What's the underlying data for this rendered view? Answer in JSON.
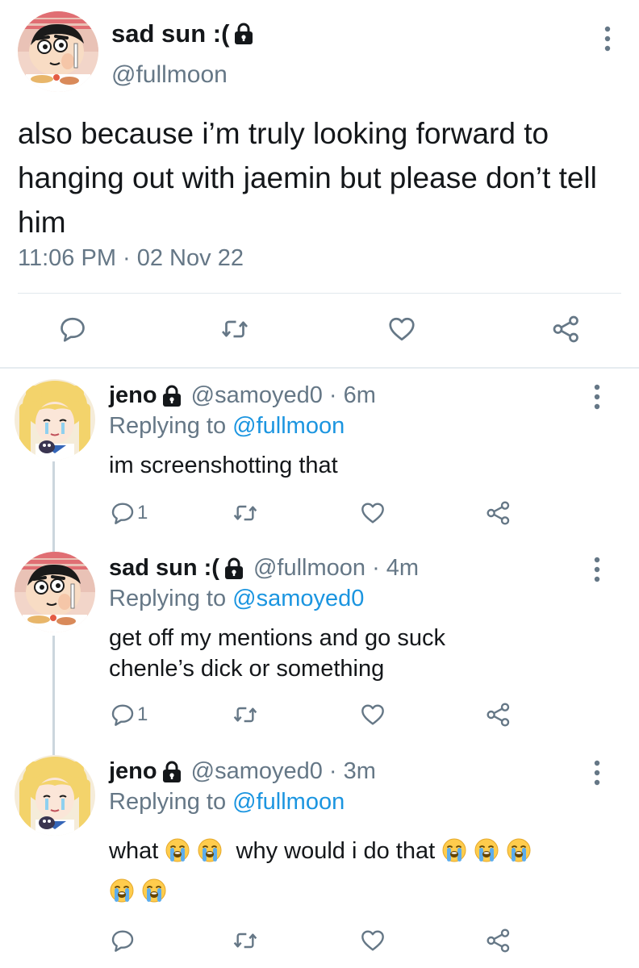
{
  "main_tweet": {
    "name": "sad sun :(",
    "handle": "@fullmoon",
    "text": "also because i’m truly looking forward to hanging out with jaemin but please don’t tell him",
    "timestamp": "11:06 PM · 02 Nov 22",
    "icons": [
      "lock-icon",
      "more-vertical-icon",
      "reply-icon",
      "retweet-icon",
      "like-icon",
      "share-icon"
    ]
  },
  "replies": [
    {
      "name": "jeno",
      "handle": "@samoyed0 · 6m",
      "replying_prefix": "Replying to",
      "replying_to": "@fullmoon",
      "text": "im screenshotting that",
      "reply_count": "1"
    },
    {
      "name": "sad sun :(",
      "handle": "@fullmoon · 4m",
      "replying_prefix": "Replying to",
      "replying_to": "@samoyed0",
      "text_line1": "get off my mentions and go suck",
      "text_line2": "chenle’s dick or something",
      "reply_count": "1"
    },
    {
      "name": "jeno",
      "handle": "@samoyed0 · 3m",
      "replying_prefix": "Replying to",
      "replying_to": "@fullmoon",
      "text_part1": "what",
      "text_part2": "why would i do that",
      "emoji": "loudly-crying-face"
    }
  ],
  "colors": {
    "text": "#14171a",
    "secondary": "#657786",
    "link": "#1b95e0",
    "divider": "#e1e8ed",
    "thread_line": "#ccd6dd"
  }
}
